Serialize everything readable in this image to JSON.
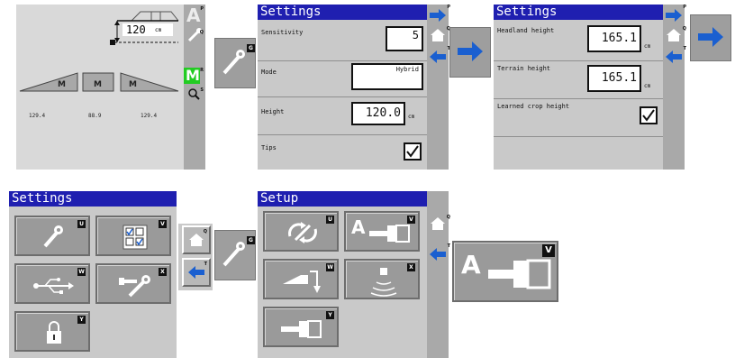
{
  "run_screen": {
    "height_value": "120",
    "height_unit": "cm",
    "sections": [
      "M",
      "M",
      "M"
    ],
    "readings": [
      "129.4",
      "88.9",
      "129.4"
    ],
    "side_letters": [
      "A",
      "M"
    ],
    "side_badges": [
      "P",
      "Q",
      "R",
      "S"
    ]
  },
  "wrench_tile_1": {
    "letter": "G"
  },
  "settings_a": {
    "title": "Settings",
    "rows": {
      "sensitivity": {
        "label": "Sensitivity",
        "value": "5"
      },
      "mode": {
        "label": "Mode",
        "value": "Hybrid"
      },
      "height": {
        "label": "Height",
        "value": "120.0",
        "unit": "cm"
      },
      "tips": {
        "label": "Tips"
      }
    },
    "side_badges": [
      "P",
      "Q",
      "T"
    ]
  },
  "settings_b": {
    "title": "Settings",
    "rows": {
      "headland": {
        "label": "Headland height",
        "value": "165.1",
        "unit": "cm"
      },
      "terrain": {
        "label": "Terrain height",
        "value": "165.1",
        "unit": "cm"
      },
      "learned": {
        "label": "Learned crop height"
      }
    },
    "side_badges": [
      "P",
      "Q",
      "T"
    ]
  },
  "settings_c": {
    "title": "Settings",
    "tile_letters": [
      "U",
      "V",
      "W",
      "X",
      "Y"
    ],
    "side_badges": [
      "Q",
      "T"
    ]
  },
  "wrench_tile_2": {
    "letter": "G"
  },
  "setup": {
    "title": "Setup",
    "tile_letters": [
      "U",
      "V",
      "W",
      "X",
      "Y"
    ],
    "side_badges": [
      "Q",
      "T"
    ]
  },
  "big_tile": {
    "letter": "V",
    "glyph": "A"
  },
  "colors": {
    "title_bar": "#1f1fb0",
    "arrow_blue": "#1a5fd0",
    "active_green": "#22cc22"
  }
}
